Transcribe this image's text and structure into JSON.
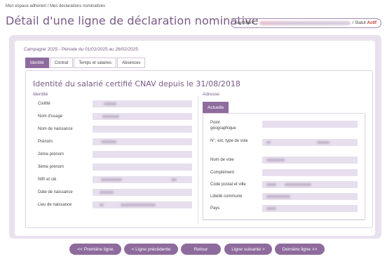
{
  "breadcrumb": "Mon espace adhérent / Mes déclarations nominatives",
  "page_title": "Détail d'une ligne de déclaration nominative",
  "id_box": {
    "label": "Identifiant",
    "statut_label": "/ Statut",
    "statut_value": "Actif"
  },
  "campagne": "Campagne 2025 - Période du 01/02/2025 au 28/02/2025",
  "tabs": [
    "Identité",
    "Contrat",
    "Temps et salaires",
    "Absences"
  ],
  "section_title": "Identité du salarié certifié CNAV depuis le 31/08/2018",
  "identite": {
    "title": "Identité",
    "fields": [
      "Civilité",
      "Nom d'usage",
      "Nom de naissance",
      "Prénom",
      "2ème prénom",
      "3ème prénom",
      "NIR et clé",
      "Date de naissance",
      "Lieu de naissance"
    ]
  },
  "adresse": {
    "title": "Adresse",
    "tab": "Actuelle",
    "fields": [
      "Point géographique",
      "N°, ext, type de voie",
      "Nom de voie",
      "Complément",
      "Code postal et ville",
      "Libellé commune",
      "Pays"
    ]
  },
  "buttons": {
    "first": "<< Première ligne",
    "prev": "< Ligne précédente",
    "back": "Retour",
    "next": "Ligne suivante >",
    "last": "Dernière ligne >>"
  },
  "colors": {
    "accent": "#8e6b9d",
    "title": "#7a5a86",
    "field_bg": "#e7dfed",
    "status_actif": "#c0392b"
  }
}
